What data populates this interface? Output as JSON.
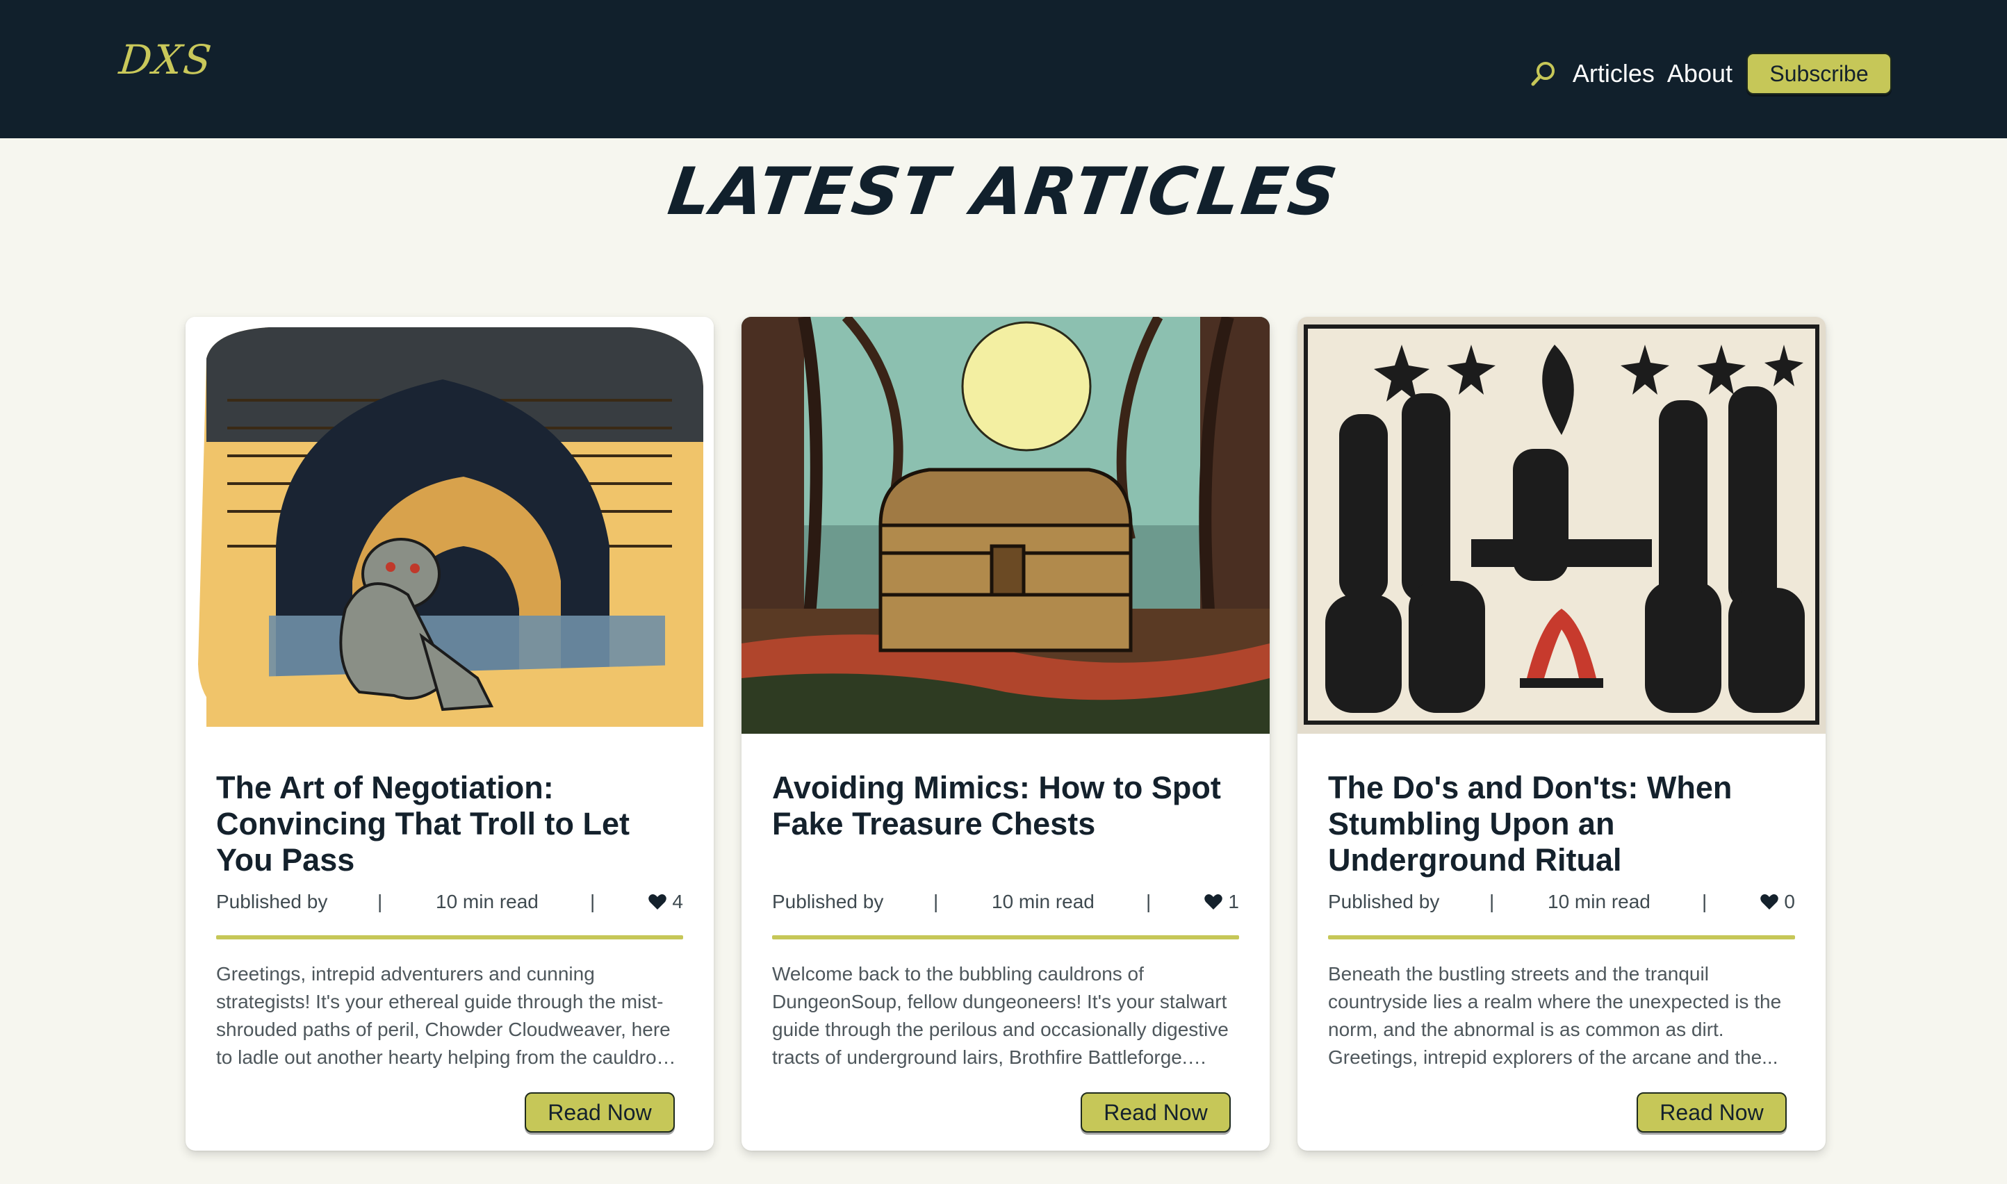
{
  "header": {
    "logo": "DXS",
    "nav": {
      "articles": "Articles",
      "about": "About",
      "subscribe": "Subscribe"
    },
    "background_color": "#11202c",
    "accent_color": "#c6c758"
  },
  "page_title": "LATEST ARTICLES",
  "articles": [
    {
      "title": "The Art of Negotiation: Convincing That Troll to Let You Pass",
      "published_by": "Published by",
      "separator": "|",
      "read_time": "10 min read",
      "likes": "4",
      "excerpt": "Greetings, intrepid adventurers and cunning strategists! It's your ethereal guide through the mist-shrouded paths of peril, Chowder Cloudweaver, here to ladle out another hearty helping from the cauldron of wisdom and advice...",
      "button": "Read Now",
      "image_icon": "troll-under-bridge-illustration"
    },
    {
      "title": "Avoiding Mimics: How to Spot Fake Treasure Chests",
      "published_by": "Published by",
      "separator": "|",
      "read_time": "10 min read",
      "likes": "1",
      "excerpt": "Welcome back to the bubbling cauldrons of DungeonSoup, fellow dungeoneers! It's your stalwart guide through the perilous and occasionally digestive tracts of underground lairs, Brothfire Battleforge. Today...",
      "button": "Read Now",
      "image_icon": "treasure-chest-forest-illustration"
    },
    {
      "title": "The Do's and Don'ts: When Stumbling Upon an Underground Ritual",
      "published_by": "Published by",
      "separator": "|",
      "read_time": "10 min read",
      "likes": "0",
      "excerpt": "Beneath the bustling streets and the tranquil countryside lies a realm where the unexpected is the norm, and the abnormal is as common as dirt. Greetings, intrepid explorers of the arcane and the...",
      "button": "Read Now",
      "image_icon": "underground-ritual-woodcut-illustration"
    }
  ]
}
